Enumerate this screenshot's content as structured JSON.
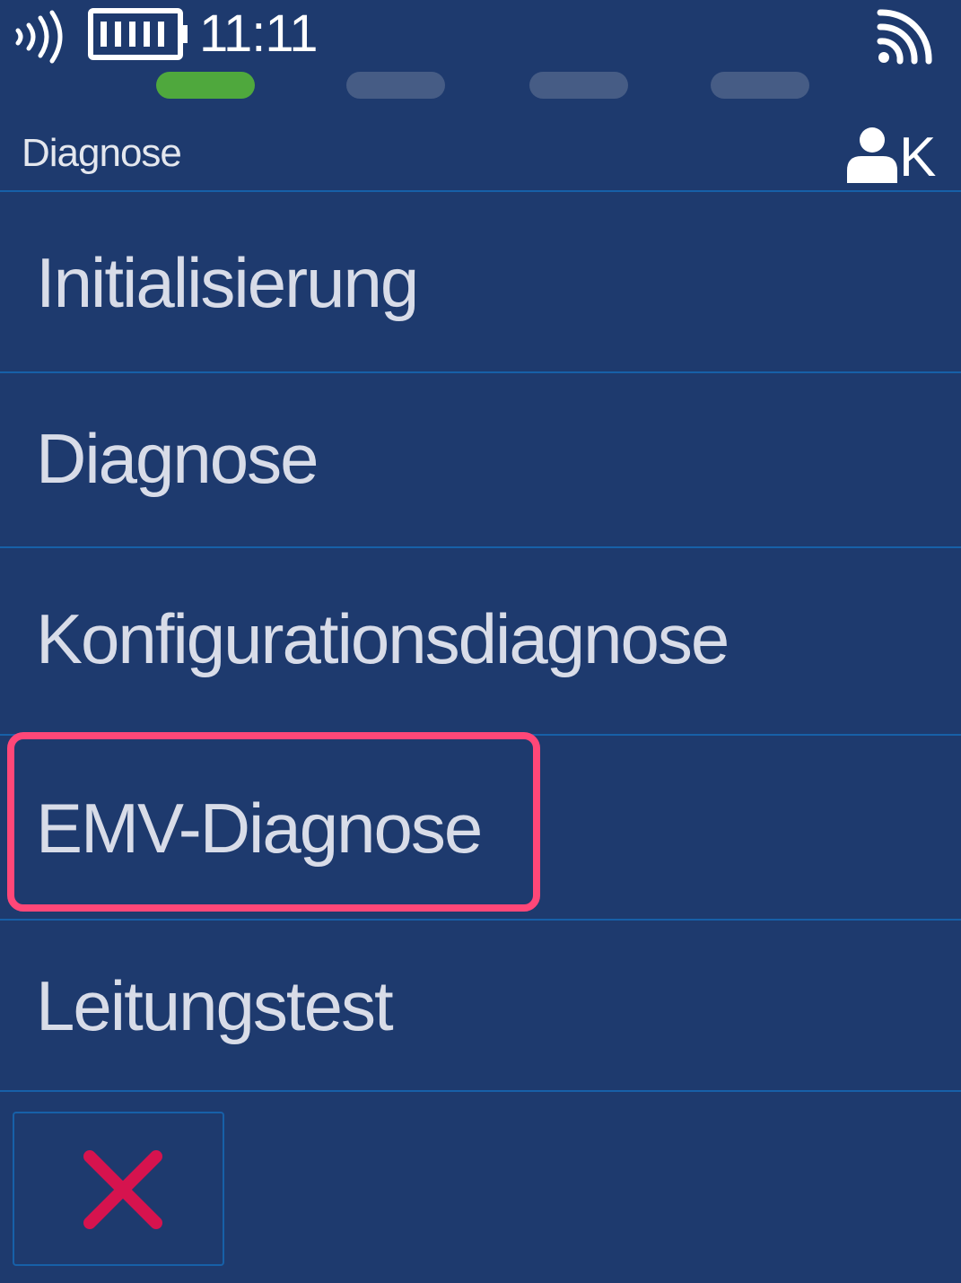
{
  "status_bar": {
    "time": "11:11",
    "icons": [
      "contactless-icon",
      "battery-icon",
      "wifi-icon"
    ]
  },
  "progress_steps": {
    "total": 4,
    "active_index": 0
  },
  "header": {
    "title": "Diagnose",
    "user_icon": "user-icon",
    "user_label": "K"
  },
  "menu": {
    "items": [
      {
        "label": "Initialisierung"
      },
      {
        "label": "Diagnose"
      },
      {
        "label": "Konfigurationsdiagnose"
      },
      {
        "label": "EMV-Diagnose",
        "highlighted": true
      },
      {
        "label": "Leitungstest"
      }
    ]
  },
  "footer": {
    "close_icon": "close-icon"
  },
  "colors": {
    "background": "#1e3a6e",
    "divider": "#1760a8",
    "step_active": "#4fa83d",
    "step_inactive": "#465c85",
    "highlight": "#ff4778",
    "close_icon": "#d6134e",
    "text": "#d8dce8"
  }
}
